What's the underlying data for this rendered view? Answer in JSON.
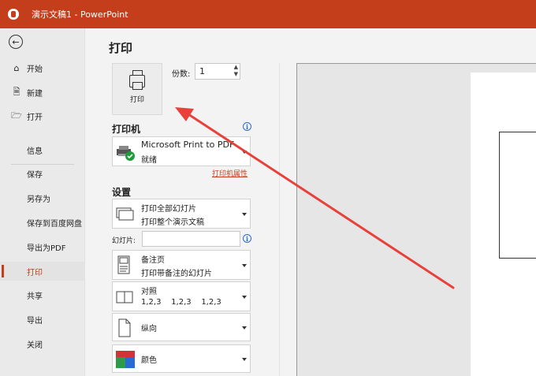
{
  "window": {
    "title": "演示文稿1 - PowerPoint",
    "accent": "#c43e1c"
  },
  "sidebar": {
    "items": [
      {
        "label": "开始",
        "icon": "home-icon"
      },
      {
        "label": "新建",
        "icon": "new-document-icon"
      },
      {
        "label": "打开",
        "icon": "folder-open-icon"
      },
      {
        "label": "信息"
      },
      {
        "label": "保存"
      },
      {
        "label": "另存为"
      },
      {
        "label": "保存到百度网盘"
      },
      {
        "label": "导出为PDF"
      },
      {
        "label": "打印",
        "active": true
      },
      {
        "label": "共享"
      },
      {
        "label": "导出"
      },
      {
        "label": "关闭"
      }
    ]
  },
  "print": {
    "title": "打印",
    "button_label": "打印",
    "copies_label": "份数:",
    "copies_value": "1"
  },
  "printer": {
    "heading": "打印机",
    "name": "Microsoft Print to PDF",
    "status": "就绪",
    "properties_link": "打印机属性"
  },
  "settings": {
    "heading": "设置",
    "range": {
      "line1": "打印全部幻灯片",
      "line2": "打印整个演示文稿"
    },
    "slides_label": "幻灯片:",
    "slides_value": "",
    "layout": {
      "line1": "备注页",
      "line2": "打印带备注的幻灯片"
    },
    "collate": {
      "line1": "对照",
      "line2": "1,2,3    1,2,3    1,2,3"
    },
    "orientation": {
      "line1": "纵向"
    },
    "color": {
      "line1": "颜色"
    }
  }
}
